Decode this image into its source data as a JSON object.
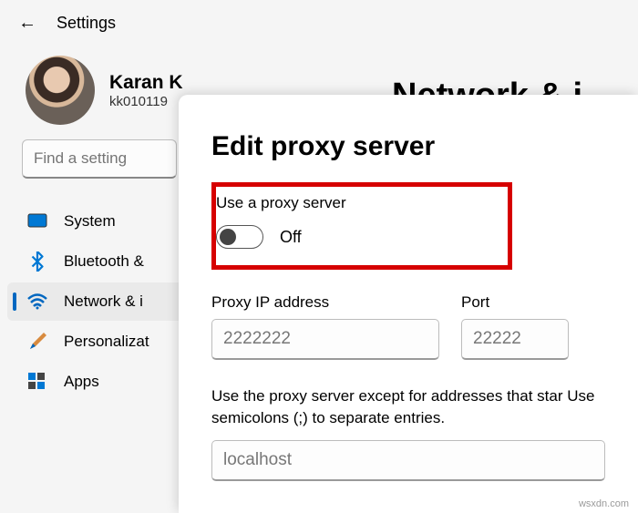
{
  "header": {
    "title": "Settings"
  },
  "profile": {
    "name": "Karan K",
    "email": "kk010119"
  },
  "search": {
    "placeholder": "Find a setting"
  },
  "nav": {
    "items": [
      {
        "label": "System"
      },
      {
        "label": "Bluetooth &"
      },
      {
        "label": "Network & i"
      },
      {
        "label": "Personalizat"
      },
      {
        "label": "Apps"
      }
    ]
  },
  "page_title_bg": "Network & i",
  "dialog": {
    "title": "Edit proxy server",
    "toggle_label": "Use a proxy server",
    "toggle_state": "Off",
    "ip_label": "Proxy IP address",
    "ip_value": "2222222",
    "port_label": "Port",
    "port_value": "22222",
    "help_text": "Use the proxy server except for addresses that star Use semicolons (;) to separate entries.",
    "exceptions_value": "localhost"
  },
  "watermark": "wsxdn.com"
}
